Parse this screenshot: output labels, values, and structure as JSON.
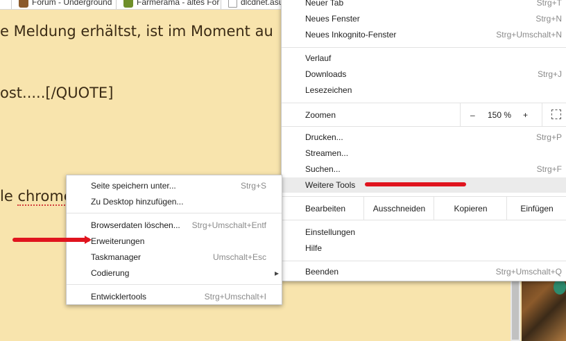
{
  "bookmarks": [
    {
      "label": "Forum - Underground"
    },
    {
      "label": "Farmerama - altes For"
    },
    {
      "label": "dlcdnet.asu"
    }
  ],
  "forum": {
    "line1": "e Meldung erhältst, ist im Moment au",
    "line2": "ost.....[/QUOTE]",
    "line3_prefix": "le ",
    "line3_word": "chrome"
  },
  "chrome_menu": {
    "new_tab": {
      "label": "Neuer Tab",
      "shortcut": "Strg+T"
    },
    "new_window": {
      "label": "Neues Fenster",
      "shortcut": "Strg+N"
    },
    "new_incognito": {
      "label": "Neues Inkognito-Fenster",
      "shortcut": "Strg+Umschalt+N"
    },
    "history": {
      "label": "Verlauf"
    },
    "downloads": {
      "label": "Downloads",
      "shortcut": "Strg+J"
    },
    "bookmarks": {
      "label": "Lesezeichen"
    },
    "zoom": {
      "label": "Zoomen",
      "minus": "–",
      "value": "150 %",
      "plus": "+"
    },
    "print": {
      "label": "Drucken...",
      "shortcut": "Strg+P"
    },
    "cast": {
      "label": "Streamen..."
    },
    "find": {
      "label": "Suchen...",
      "shortcut": "Strg+F"
    },
    "more_tools": {
      "label": "Weitere Tools"
    },
    "edit": {
      "label": "Bearbeiten",
      "cut": "Ausschneiden",
      "copy": "Kopieren",
      "paste": "Einfügen"
    },
    "settings": {
      "label": "Einstellungen"
    },
    "help": {
      "label": "Hilfe"
    },
    "exit": {
      "label": "Beenden",
      "shortcut": "Strg+Umschalt+Q"
    }
  },
  "tools_menu": {
    "save_page": {
      "label": "Seite speichern unter...",
      "shortcut": "Strg+S"
    },
    "add_desktop": {
      "label": "Zu Desktop hinzufügen..."
    },
    "clear_data": {
      "label": "Browserdaten löschen...",
      "shortcut": "Strg+Umschalt+Entf"
    },
    "extensions": {
      "label": "Erweiterungen"
    },
    "task_manager": {
      "label": "Taskmanager",
      "shortcut": "Umschalt+Esc"
    },
    "encoding": {
      "label": "Codierung",
      "submenu_arrow": "▸"
    },
    "dev_tools": {
      "label": "Entwicklertools",
      "shortcut": "Strg+Umschalt+I"
    }
  },
  "colors": {
    "page_bg": "#f8e4ad",
    "annotation_red": "#e0141e",
    "highlight": "#ebebeb"
  }
}
